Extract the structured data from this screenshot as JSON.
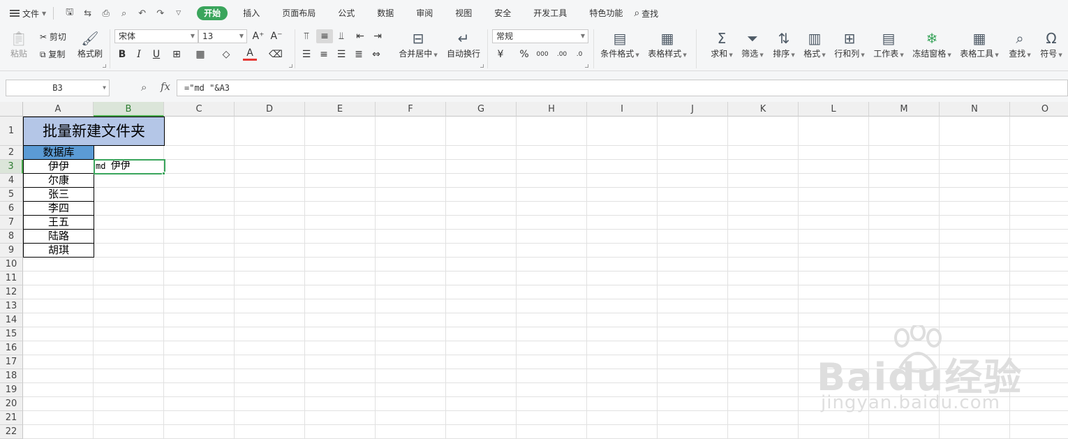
{
  "menubar": {
    "file_label": "文件",
    "tabs": [
      "开始",
      "插入",
      "页面布局",
      "公式",
      "数据",
      "审阅",
      "视图",
      "安全",
      "开发工具",
      "特色功能"
    ],
    "search_label": "查找"
  },
  "ribbon": {
    "paste": "粘贴",
    "cut": "剪切",
    "copy": "复制",
    "format_painter": "格式刷",
    "font_name": "宋体",
    "font_size": "13",
    "merge_center": "合并居中",
    "wrap_text": "自动换行",
    "number_format": "常规",
    "conditional_format": "条件格式",
    "table_style": "表格样式",
    "sum": "求和",
    "filter": "筛选",
    "sort": "排序",
    "format": "格式",
    "row_col": "行和列",
    "worksheet": "工作表",
    "freeze": "冻结窗格",
    "table_tools": "表格工具",
    "find": "查找",
    "symbol": "符号"
  },
  "formula_bar": {
    "name_box": "B3",
    "fx": "fx",
    "formula": "=\"md \"&A3"
  },
  "sheet": {
    "columns": [
      "A",
      "B",
      "C",
      "D",
      "E",
      "F",
      "G",
      "H",
      "I",
      "J",
      "K",
      "L",
      "M",
      "N",
      "O"
    ],
    "rows": [
      "1",
      "2",
      "3",
      "4",
      "5",
      "6",
      "7",
      "8",
      "9",
      "10",
      "11",
      "12",
      "13",
      "14",
      "15",
      "16",
      "17",
      "18",
      "19",
      "20",
      "21",
      "22"
    ],
    "title": "批量新建文件夹",
    "header": "数据库",
    "names": [
      "伊伊",
      "尔康",
      "张三",
      "李四",
      "王五",
      "陆路",
      "胡琪"
    ],
    "b3_prefix": "md ",
    "b3_name": "伊伊"
  },
  "watermark": {
    "logo": "Baidu经验",
    "url": "jingyan.baidu.com"
  },
  "colors": {
    "active_tab": "#3aa55c",
    "title_fill": "#b4c6e7",
    "header_fill": "#5b9bd5",
    "selection": "#3aa55c"
  }
}
